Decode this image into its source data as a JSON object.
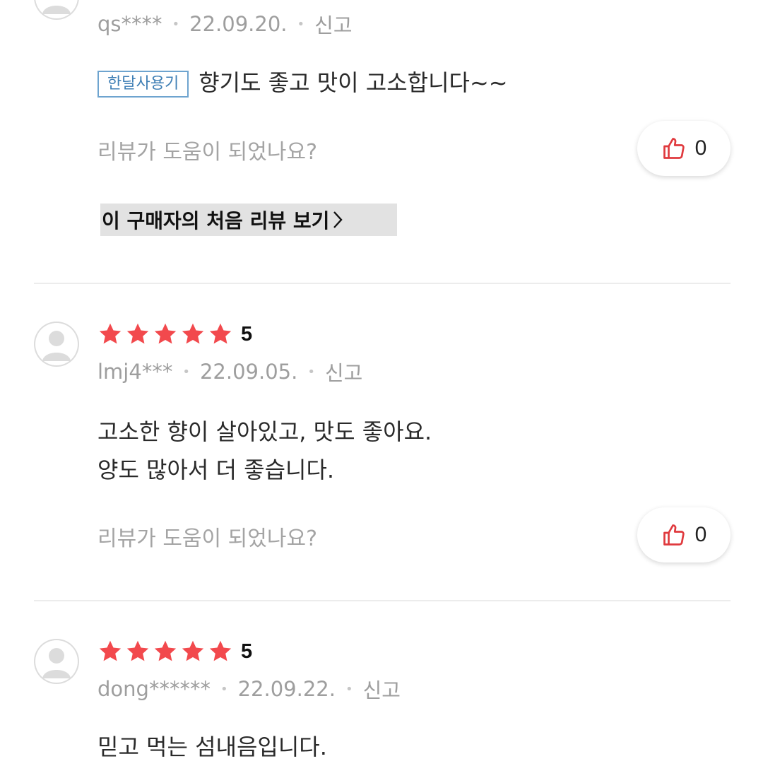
{
  "reviews": [
    {
      "user": "qs****",
      "date": "22.09.20.",
      "report_label": "신고",
      "tag": "한달사용기",
      "text": "향기도 좋고 맛이 고소합니다~~",
      "helpful_question": "리뷰가 도움이 되었나요?",
      "likes": "0",
      "first_review_link": "이 구매자의 처음 리뷰 보기"
    },
    {
      "rating": "5",
      "stars": 5,
      "user": "lmj4***",
      "date": "22.09.05.",
      "report_label": "신고",
      "text_lines": [
        "고소한 향이 살아있고, 맛도 좋아요.",
        "양도 많아서 더 좋습니다."
      ],
      "helpful_question": "리뷰가 도움이 되었나요?",
      "likes": "0"
    },
    {
      "rating": "5",
      "stars": 5,
      "user": "dong******",
      "date": "22.09.22.",
      "report_label": "신고",
      "text": "믿고 먹는 섬내음입니다."
    }
  ],
  "colors": {
    "star": "#f2494d",
    "like_icon": "#e03a3e",
    "tag_border": "#6ea4cf"
  },
  "icons": {
    "avatar": "default-user-silhouette",
    "like": "thumbs-up-outline",
    "link_arrow": "chevron-right"
  }
}
